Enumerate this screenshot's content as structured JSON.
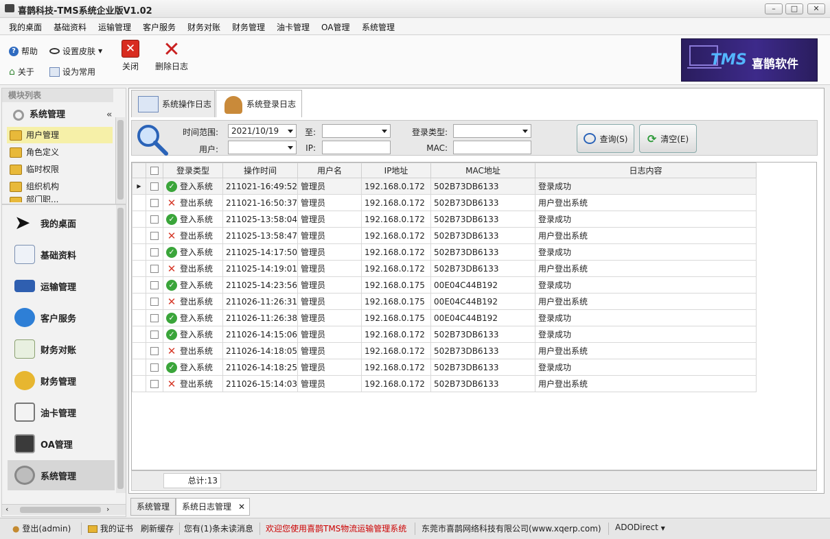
{
  "window": {
    "title": "喜鹊科技-TMS系统企业版V1.02"
  },
  "menu": [
    "我的桌面",
    "基础资料",
    "运输管理",
    "客户服务",
    "财务对账",
    "财务管理",
    "油卡管理",
    "OA管理",
    "系统管理"
  ],
  "toolbar": {
    "help": "帮助",
    "skin": "设置皮肤",
    "about": "关于",
    "favorite": "设为常用",
    "close": "关闭",
    "delete_log": "删除日志",
    "banner_tms": "TMS",
    "banner_name": "喜鹊软件"
  },
  "left": {
    "module_list": "模块列表",
    "section": "系统管理",
    "collapse": "«",
    "tree": [
      "用户管理",
      "角色定义",
      "临时权限",
      "组织机构",
      "部门职..."
    ],
    "nav": [
      "我的桌面",
      "基础资料",
      "运输管理",
      "客户服务",
      "财务对账",
      "财务管理",
      "油卡管理",
      "OA管理",
      "系统管理"
    ]
  },
  "tabs": [
    "系统操作日志",
    "系统登录日志"
  ],
  "filter": {
    "time_range_label": "时间范围:",
    "time_from": "2021/10/19",
    "to_label": "至:",
    "time_to": "",
    "login_type_label": "登录类型:",
    "login_type": "",
    "user_label": "用户:",
    "user": "",
    "ip_label": "IP:",
    "ip": "",
    "mac_label": "MAC:",
    "mac": "",
    "query_button": "查询(S)",
    "clear_button": "清空(E)"
  },
  "grid": {
    "columns": [
      "登录类型",
      "操作时间",
      "用户名",
      "IP地址",
      "MAC地址",
      "日志内容"
    ],
    "rows": [
      {
        "type": "登入系统",
        "ok": true,
        "time": "211021-16:49:52",
        "user": "管理员",
        "ip": "192.168.0.172",
        "mac": "502B73DB6133",
        "content": "登录成功"
      },
      {
        "type": "登出系统",
        "ok": false,
        "time": "211021-16:50:37",
        "user": "管理员",
        "ip": "192.168.0.172",
        "mac": "502B73DB6133",
        "content": "用户登出系统"
      },
      {
        "type": "登入系统",
        "ok": true,
        "time": "211025-13:58:04",
        "user": "管理员",
        "ip": "192.168.0.172",
        "mac": "502B73DB6133",
        "content": "登录成功"
      },
      {
        "type": "登出系统",
        "ok": false,
        "time": "211025-13:58:47",
        "user": "管理员",
        "ip": "192.168.0.172",
        "mac": "502B73DB6133",
        "content": "用户登出系统"
      },
      {
        "type": "登入系统",
        "ok": true,
        "time": "211025-14:17:50",
        "user": "管理员",
        "ip": "192.168.0.172",
        "mac": "502B73DB6133",
        "content": "登录成功"
      },
      {
        "type": "登出系统",
        "ok": false,
        "time": "211025-14:19:01",
        "user": "管理员",
        "ip": "192.168.0.172",
        "mac": "502B73DB6133",
        "content": "用户登出系统"
      },
      {
        "type": "登入系统",
        "ok": true,
        "time": "211025-14:23:56",
        "user": "管理员",
        "ip": "192.168.0.175",
        "mac": "00E04C44B192",
        "content": "登录成功"
      },
      {
        "type": "登出系统",
        "ok": false,
        "time": "211026-11:26:31",
        "user": "管理员",
        "ip": "192.168.0.175",
        "mac": "00E04C44B192",
        "content": "用户登出系统"
      },
      {
        "type": "登入系统",
        "ok": true,
        "time": "211026-11:26:38",
        "user": "管理员",
        "ip": "192.168.0.175",
        "mac": "00E04C44B192",
        "content": "登录成功"
      },
      {
        "type": "登入系统",
        "ok": true,
        "time": "211026-14:15:06",
        "user": "管理员",
        "ip": "192.168.0.172",
        "mac": "502B73DB6133",
        "content": "登录成功"
      },
      {
        "type": "登出系统",
        "ok": false,
        "time": "211026-14:18:05",
        "user": "管理员",
        "ip": "192.168.0.172",
        "mac": "502B73DB6133",
        "content": "用户登出系统"
      },
      {
        "type": "登入系统",
        "ok": true,
        "time": "211026-14:18:25",
        "user": "管理员",
        "ip": "192.168.0.172",
        "mac": "502B73DB6133",
        "content": "登录成功"
      },
      {
        "type": "登出系统",
        "ok": false,
        "time": "211026-15:14:03",
        "user": "管理员",
        "ip": "192.168.0.172",
        "mac": "502B73DB6133",
        "content": "用户登出系统"
      }
    ],
    "total": "总计:13"
  },
  "bottom_tabs": [
    "系统管理",
    "系统日志管理"
  ],
  "status": {
    "logout": "登出(admin)",
    "cert": "我的证书",
    "refresh": "刷新缓存",
    "unread": "您有(1)条未读消息",
    "welcome": "欢迎您使用喜鹊TMS物流运输管理系统",
    "company": "东莞市喜鹊网络科技有限公司(www.xqerp.com)",
    "ado": "ADODirect"
  },
  "colors": {
    "accent": "#3a7bd5",
    "selected": "#f6f0a8",
    "welcome": "#cc0000"
  }
}
